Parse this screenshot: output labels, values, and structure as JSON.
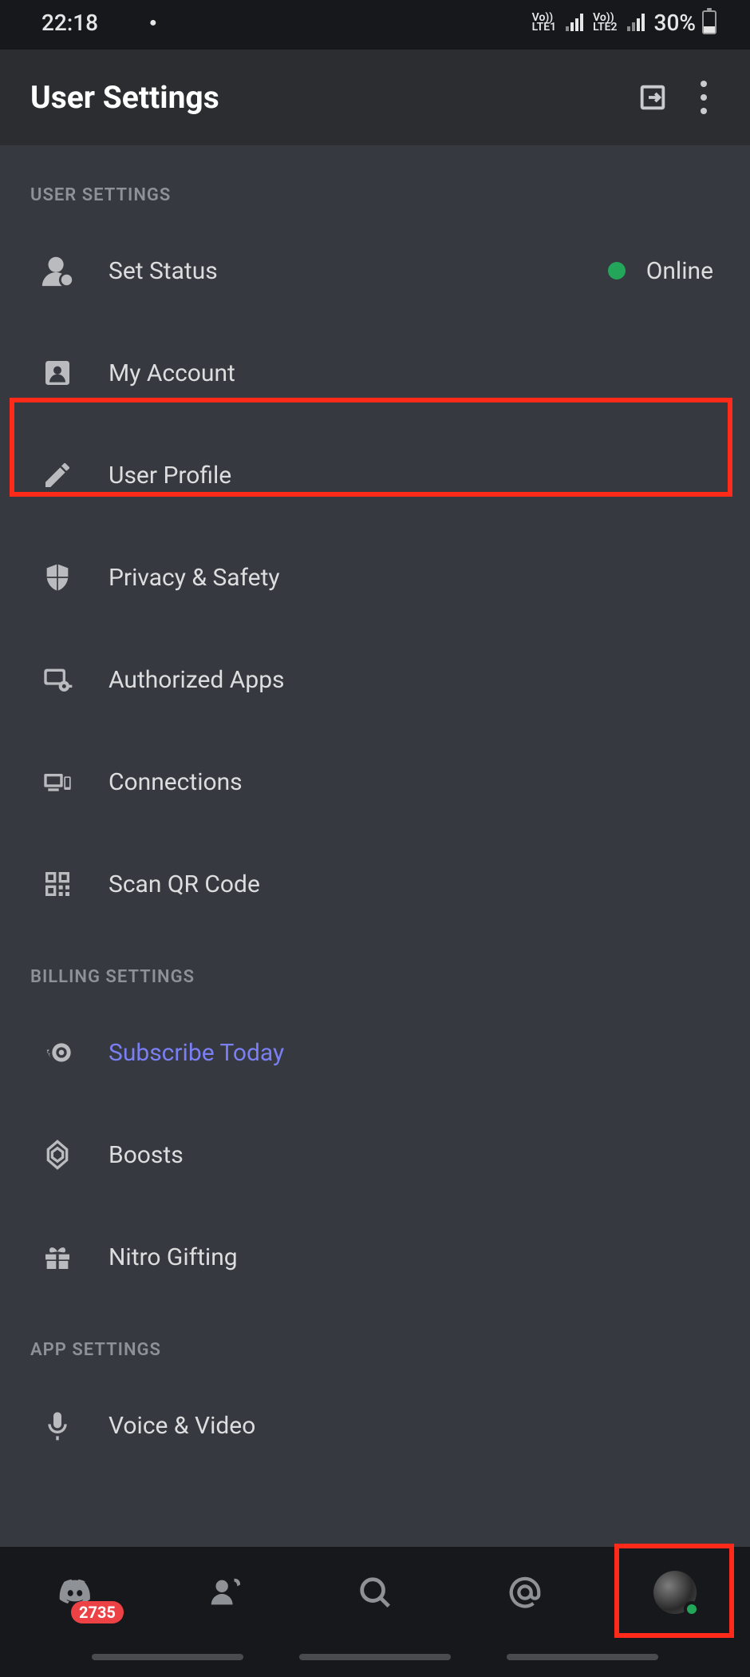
{
  "statusbar": {
    "time": "22:18",
    "battery_text": "30%",
    "battery_pct": 30,
    "lte1": "Vo))\nLTE1",
    "lte2": "Vo))\nLTE2"
  },
  "appbar": {
    "title": "User Settings"
  },
  "sections": {
    "user": {
      "header": "USER SETTINGS",
      "items": {
        "set_status": {
          "label": "Set Status",
          "value_label": "Online",
          "dot_color": "#23a55a"
        },
        "my_account": {
          "label": "My Account"
        },
        "user_profile": {
          "label": "User Profile"
        },
        "privacy_safety": {
          "label": "Privacy & Safety"
        },
        "authorized_apps": {
          "label": "Authorized Apps"
        },
        "connections": {
          "label": "Connections"
        },
        "scan_qr": {
          "label": "Scan QR Code"
        }
      }
    },
    "billing": {
      "header": "BILLING SETTINGS",
      "items": {
        "subscribe_today": {
          "label": "Subscribe Today"
        },
        "boosts": {
          "label": "Boosts"
        },
        "nitro_gifting": {
          "label": "Nitro Gifting"
        }
      }
    },
    "app": {
      "header": "APP SETTINGS",
      "items": {
        "voice_video": {
          "label": "Voice & Video"
        }
      }
    }
  },
  "bottom_nav": {
    "badge_count": "2735",
    "presence_color": "#23a55a"
  },
  "colors": {
    "highlight": "#ff2a1a",
    "accent_link": "#7a7ff3"
  }
}
